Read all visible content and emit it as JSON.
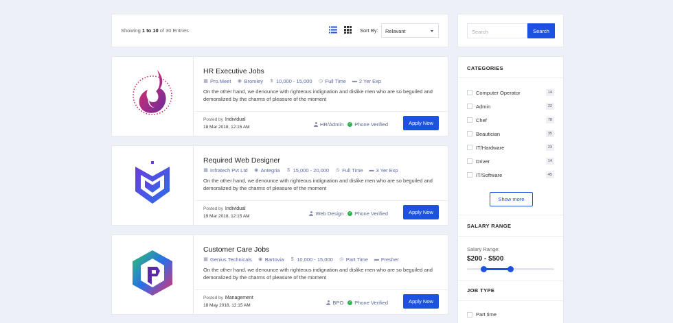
{
  "toolbar": {
    "showing_prefix": "Showing",
    "from": "1",
    "to_word": "to",
    "to": "10",
    "of_word": "of",
    "total_text": "30 Entries",
    "sort_label": "Sort By:",
    "sort_value": "Relavant",
    "icons": [
      "list-view-icon",
      "grid-view-icon"
    ]
  },
  "jobs": [
    {
      "title": "HR Executive Jobs",
      "company": "Pro.Meet",
      "location": "Bromley",
      "salary": "10,000 - 15,000",
      "type": "Full Time",
      "experience": "2 Yer Exp",
      "description": "On the other hand, we denounce with righteous indignation and dislike men who are so beguiled and demoralized by the charms of pleasure of the moment",
      "posted_by_label": "Posted by",
      "posted_by": "Individual",
      "date": "18 Mar 2018, 12:15 AM",
      "category": "HR/Admin",
      "verified": "Phone Verified",
      "apply_label": "Apply Now"
    },
    {
      "title": "Required Web Designer",
      "company": "Infratech Pvt Ltd",
      "location": "Antegria",
      "salary": "15,000 - 20,000",
      "type": "Full Time",
      "experience": "3 Yer Exp",
      "description": "On the other hand, we denounce with righteous indignation and dislike men who are so beguiled and demoralized by the charms of pleasure of the moment",
      "posted_by_label": "Posted by",
      "posted_by": "Individual",
      "date": "19 Mar 2018, 12:15 AM",
      "category": "Web Design",
      "verified": "Phone Verified",
      "apply_label": "Apply Now"
    },
    {
      "title": "Customer Care Jobs",
      "company": "Genius Technicals",
      "location": "Bartovia",
      "salary": "10,000 - 15,000",
      "type": "Part Time",
      "experience": "Fresher",
      "description": "On the other hand, we denounce with righteous indignation and dislike men who are so beguiled and demoralized by the charms of pleasure of the moment",
      "posted_by_label": "Posted by",
      "posted_by": "Management",
      "date": "18 May 2018, 12:15 AM",
      "category": "BPO",
      "verified": "Phone Verified",
      "apply_label": "Apply Now"
    }
  ],
  "search": {
    "placeholder": "Search",
    "button_label": "Search"
  },
  "sidebar": {
    "categories_title": "CATEGORIES",
    "categories": [
      {
        "name": "Computer Operator",
        "count": "14"
      },
      {
        "name": "Admin",
        "count": "22"
      },
      {
        "name": "Chef",
        "count": "78"
      },
      {
        "name": "Beautician",
        "count": "35"
      },
      {
        "name": "IT/Hardware",
        "count": "23"
      },
      {
        "name": "Driver",
        "count": "14"
      },
      {
        "name": "IT/Software",
        "count": "45"
      }
    ],
    "show_more": "Show more",
    "salary_title": "SALARY RANGE",
    "salary_label": "Salary Range:",
    "salary_value": "$200 - $500",
    "salary_slider": {
      "low_fraction": 0.19,
      "high_fraction": 0.5
    },
    "job_type_title": "JOB TYPE",
    "job_types": [
      "Part time"
    ]
  },
  "colors": {
    "accent": "#1b52e0",
    "verified": "#2bb24c",
    "meta_text": "#5a68a8",
    "background": "#eef0f8"
  }
}
